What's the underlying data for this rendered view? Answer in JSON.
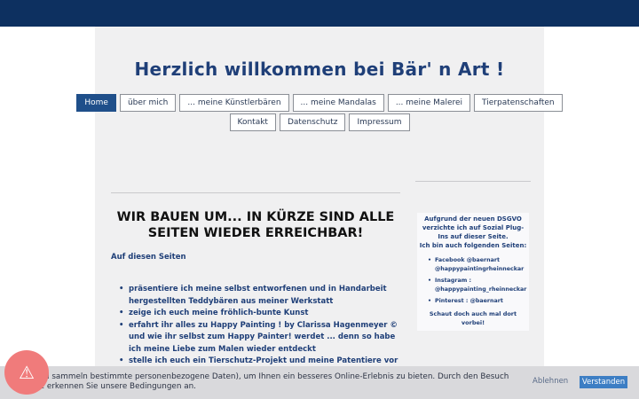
{
  "site": {
    "title": "Herzlich willkommen bei Bär' n Art !"
  },
  "nav": {
    "row1": [
      {
        "label": "Home",
        "active": true
      },
      {
        "label": "über mich"
      },
      {
        "label": "... meine Künstlerbären"
      },
      {
        "label": "... meine Mandalas"
      },
      {
        "label": "... meine Malerei"
      },
      {
        "label": "Tierpatenschaften"
      }
    ],
    "row2": [
      {
        "label": "Kontakt"
      },
      {
        "label": "Datenschutz"
      },
      {
        "label": "Impressum"
      }
    ]
  },
  "main": {
    "headline": "WIR BAUEN UM... IN KÜRZE SIND ALLE SEITEN WIEDER ERREICHBAR!",
    "lead": "Auf diesen Seiten",
    "bullets": [
      "präsentiere ich meine selbst entworfenen und in Handarbeit hergestellten Teddybären aus meiner Werkstatt",
      "zeige ich euch meine fröhlich-bunte Kunst",
      "erfahrt ihr alles zu Happy Painting ! by Clarissa Hagenmeyer © und wie ihr selbst zum Happy Painter! werdet ... denn so habe ich meine Liebe zum Malen wieder entdeckt",
      "stelle ich euch ein Tierschutz-Projekt und meine Patentiere vor"
    ]
  },
  "sidebar": {
    "notice": "Aufgrund der neuen DSGVO verzichte ich auf Sozial Plug-Ins auf dieser Seite.",
    "also_on": "Ich bin auch folgenden Seiten:",
    "links": [
      "Facebook   @baernart\n@happypaintingrheinneckar",
      "Instagram :\n@happypainting_rheinneckar",
      "Pinterest :   @baernart"
    ],
    "closing": "Schaut doch auch mal dort vorbei!"
  },
  "cookie": {
    "text": "den (und sammeln bestimmte personenbezogene Daten), um Ihnen ein besseres Online-Erlebnis zu bieten. Durch den Besuch website erkennen Sie unsere Bedingungen an.",
    "decline_label": "Ablehnen",
    "accept_label": "Verstanden"
  },
  "alert": {
    "icon": "warning-icon",
    "glyph": "⚠"
  },
  "colors": {
    "topbar": "#0d3060",
    "accent": "#1f4f8a",
    "text": "#1f3f78",
    "accept": "#3d7ec4",
    "alert": "#f07b7b"
  }
}
